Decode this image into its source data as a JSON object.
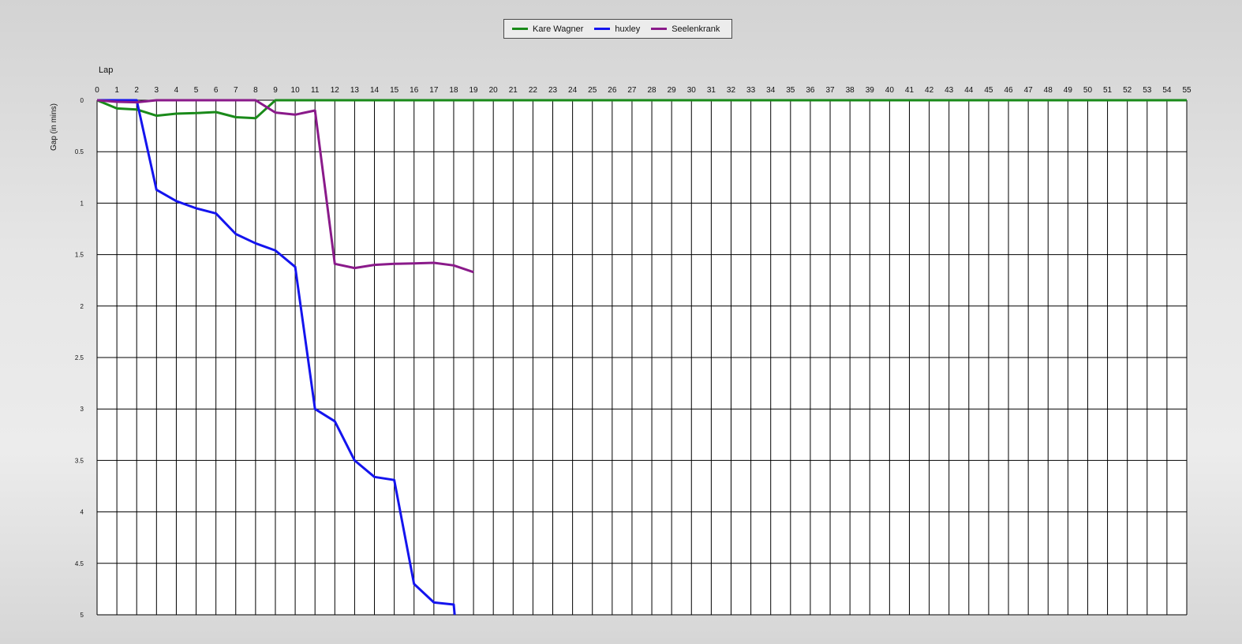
{
  "chart_data": {
    "type": "line",
    "title": "",
    "xlabel": "Lap",
    "ylabel": "Gap (in mins)",
    "x_ticks": [
      "0",
      "1",
      "2",
      "3",
      "4",
      "5",
      "6",
      "7",
      "8",
      "9",
      "10",
      "11",
      "12",
      "13",
      "14",
      "15",
      "16",
      "17",
      "18",
      "19",
      "20",
      "21",
      "22",
      "23",
      "24",
      "25",
      "26",
      "27",
      "28",
      "29",
      "30",
      "31",
      "32",
      "33",
      "34",
      "35",
      "36",
      "37",
      "38",
      "39",
      "40",
      "41",
      "42",
      "43",
      "44",
      "45",
      "46",
      "47",
      "48",
      "49",
      "50",
      "51",
      "52",
      "53",
      "54",
      "55"
    ],
    "y_ticks": [
      "0",
      "0.5",
      "1",
      "1.5",
      "2",
      "2.5",
      "3",
      "3.5",
      "4",
      "4.5",
      "5"
    ],
    "xlim": [
      0,
      55
    ],
    "ylim": [
      0,
      5
    ],
    "y_inverted": true,
    "grid": true,
    "legend_position": "top-center",
    "series": [
      {
        "name": "Kare Wagner",
        "color": "#1a8a1a",
        "x": [
          0,
          1,
          2,
          3,
          4,
          5,
          6,
          7,
          8,
          9,
          10,
          11,
          12,
          13,
          14,
          15,
          16,
          17,
          18,
          19,
          20,
          21,
          22,
          23,
          24,
          25,
          26,
          27,
          28,
          29,
          30,
          31,
          32,
          33,
          34,
          35,
          36,
          37,
          38,
          39,
          40,
          41,
          42,
          43,
          44,
          45,
          46,
          47,
          48,
          49,
          50,
          51,
          52,
          53,
          54,
          55
        ],
        "y": [
          0,
          0.08,
          0.09,
          0.15,
          0.13,
          0.125,
          0.115,
          0.165,
          0.175,
          0,
          0,
          0,
          0,
          0,
          0,
          0,
          0,
          0,
          0,
          0,
          0,
          0,
          0,
          0,
          0,
          0,
          0,
          0,
          0,
          0,
          0,
          0,
          0,
          0,
          0,
          0,
          0,
          0,
          0,
          0,
          0,
          0,
          0,
          0,
          0,
          0,
          0,
          0,
          0,
          0,
          0,
          0,
          0,
          0,
          0,
          0
        ]
      },
      {
        "name": "huxley",
        "color": "#1414ee",
        "x": [
          0,
          1,
          2,
          3,
          4,
          5,
          6,
          7,
          8,
          9,
          10,
          11,
          12,
          13,
          14,
          15,
          16,
          17,
          18,
          18.05
        ],
        "y": [
          0,
          0,
          0,
          0.87,
          0.98,
          1.05,
          1.1,
          1.3,
          1.39,
          1.46,
          1.62,
          3.0,
          3.12,
          3.5,
          3.66,
          3.69,
          4.7,
          4.88,
          4.9,
          5.0
        ]
      },
      {
        "name": "Seelenkrank",
        "color": "#8a1a8a",
        "x": [
          0,
          1,
          2,
          3,
          4,
          5,
          6,
          7,
          8,
          9,
          10,
          11,
          12,
          13,
          14,
          15,
          16,
          17,
          18,
          19
        ],
        "y": [
          0,
          0.015,
          0.02,
          0,
          0,
          0,
          0,
          0,
          0,
          0.12,
          0.14,
          0.1,
          1.59,
          1.63,
          1.6,
          1.59,
          1.585,
          1.58,
          1.605,
          1.67
        ]
      }
    ]
  }
}
